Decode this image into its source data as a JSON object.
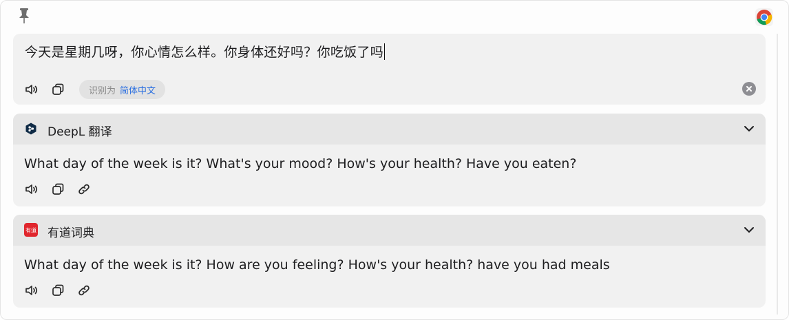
{
  "input": {
    "text": "今天是星期几呀，你心情怎么样。你身体还好吗？你吃饭了吗",
    "detected_prefix": "识别为",
    "detected_language": "简体中文"
  },
  "results": [
    {
      "service": "DeepL 翻译",
      "translation": "What day of the week is it? What's your mood? How's your health? Have you eaten?"
    },
    {
      "service": "有道词典",
      "logo_text": "有道",
      "translation": "What day of the week is it? How are you feeling? How's your health? have you had meals"
    }
  ],
  "icons": {
    "pin": "pin-icon",
    "browser": "chrome-icon",
    "speaker": "speaker-icon",
    "copy": "copy-icon",
    "link": "link-icon",
    "clear": "clear-icon",
    "chevron": "chevron-down-icon"
  },
  "colors": {
    "accent_blue": "#2b6fe0",
    "card_bg": "#f1f1f1",
    "header_bg": "#e6e6e6",
    "youdao_red": "#e0262d",
    "deepl_navy": "#0f2b46"
  }
}
